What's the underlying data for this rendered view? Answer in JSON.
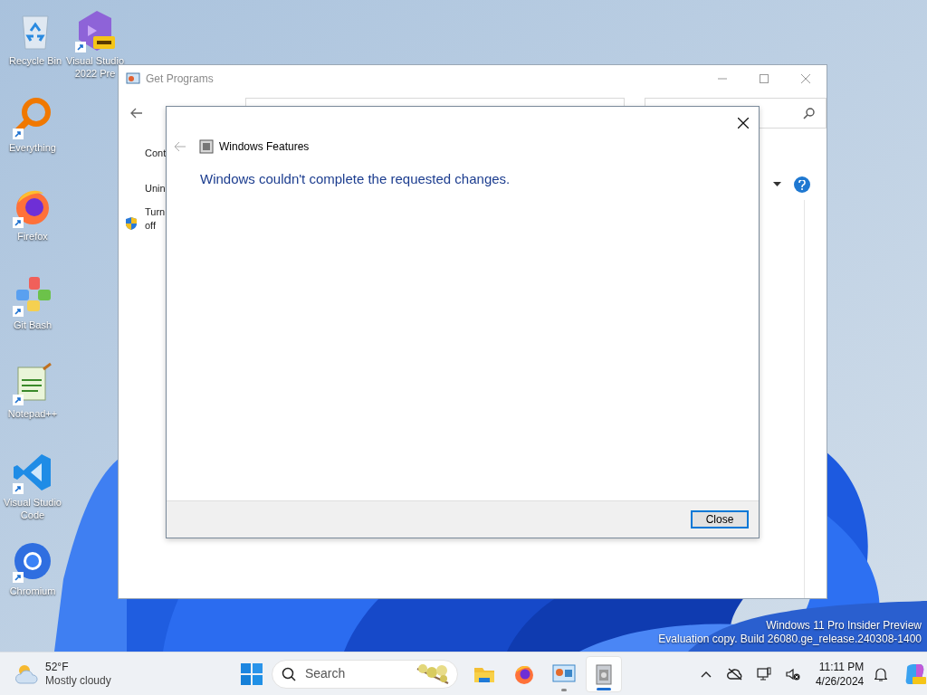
{
  "desktop_icons": [
    {
      "kind": "recycle",
      "label": "Recycle Bin",
      "shortcut": false
    },
    {
      "kind": "vs",
      "label": "Visual Studio 2022 Pre",
      "shortcut": true
    },
    {
      "kind": "everything",
      "label": "Everything",
      "shortcut": true
    },
    {
      "kind": "firefox",
      "label": "Firefox",
      "shortcut": true
    },
    {
      "kind": "git",
      "label": "Git Bash",
      "shortcut": true
    },
    {
      "kind": "notepad",
      "label": "Notepad++",
      "shortcut": true
    },
    {
      "kind": "vscode",
      "label": "Visual Studio Code",
      "shortcut": true
    },
    {
      "kind": "chromium",
      "label": "Chromium",
      "shortcut": true
    }
  ],
  "background_window": {
    "title": "Get Programs",
    "sidebar_items": [
      "Cont",
      "Unin",
      "Turn off"
    ]
  },
  "dialog": {
    "title": "Windows Features",
    "message": "Windows couldn't complete the requested changes.",
    "button": "Close"
  },
  "desktop_notice": [
    "Windows 11 Pro Insider Preview",
    "Evaluation copy. Build 26080.ge_release.240308-1400"
  ],
  "taskbar": {
    "weather": {
      "temperature": "52°F",
      "condition": "Mostly cloudy"
    },
    "search": {
      "placeholder": "Search"
    },
    "apps": [
      {
        "kind": "explorer",
        "running": false,
        "active": false
      },
      {
        "kind": "firefox",
        "running": false,
        "active": false
      },
      {
        "kind": "control",
        "running": true,
        "active": false
      },
      {
        "kind": "programs",
        "running": true,
        "active": true
      }
    ],
    "time": "11:11 PM",
    "date": "4/26/2024"
  }
}
